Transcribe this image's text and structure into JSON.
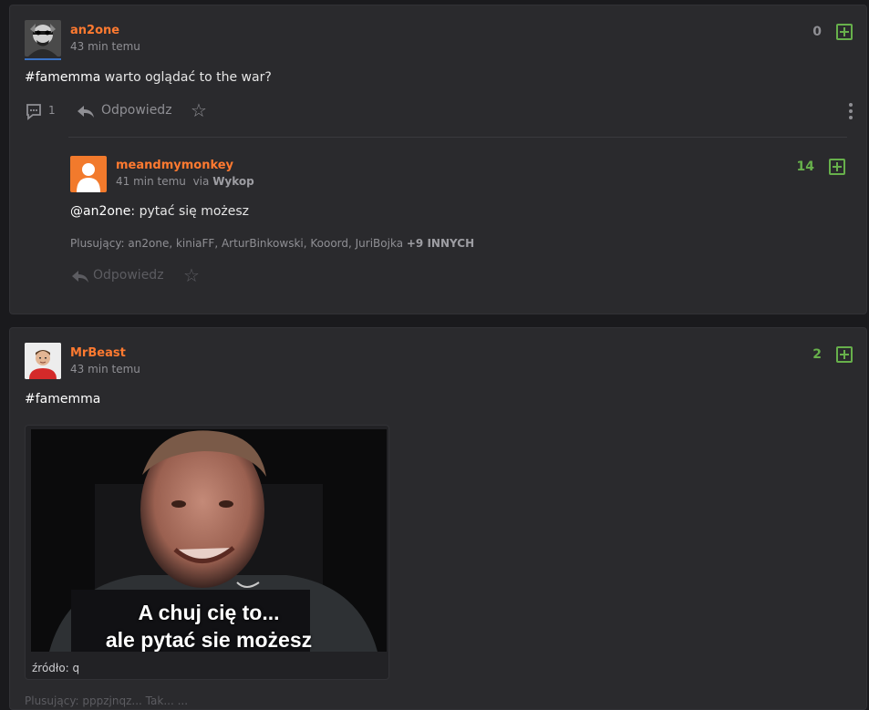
{
  "posts": [
    {
      "author": "an2one",
      "time": "43 min temu",
      "tag": "#famemma",
      "body": " warto oglądać to the war?",
      "votes": "0",
      "comment_count": "1",
      "reply_label": "Odpowiedz",
      "comments": [
        {
          "author": "meandmymonkey",
          "time": "41 min temu",
          "via_prefix": "via",
          "via": "Wykop",
          "mention": "@an2one",
          "body": ": pytać się możesz",
          "votes": "14",
          "plus_prefix": "Plusujący: an2one, kiniaFF, ArturBinkowski, Kooord, JuriBojka",
          "plus_more": "+9 INNYCH",
          "reply_label": "Odpowiedz"
        }
      ]
    },
    {
      "author": "MrBeast",
      "time": "43 min temu",
      "tag": "#famemma",
      "votes": "2",
      "image": {
        "caption_line1": "A chuj cię to...",
        "caption_line2": "ale pytać sie możesz",
        "source": "źródło: q"
      },
      "plus_partial": "Plusujący: pppzjnqz... Tak... ..."
    }
  ],
  "colors": {
    "accent": "#ff7a30",
    "positive": "#67b04b",
    "background": "#1a1a1d",
    "card": "#2a2a2d"
  },
  "icons": {
    "vote": "plus-square-icon",
    "comments": "comment-bubble-icon",
    "reply": "reply-arrow-icon",
    "favorite": "star-icon",
    "more": "kebab-menu-icon",
    "default_avatar": "user-silhouette-icon"
  }
}
